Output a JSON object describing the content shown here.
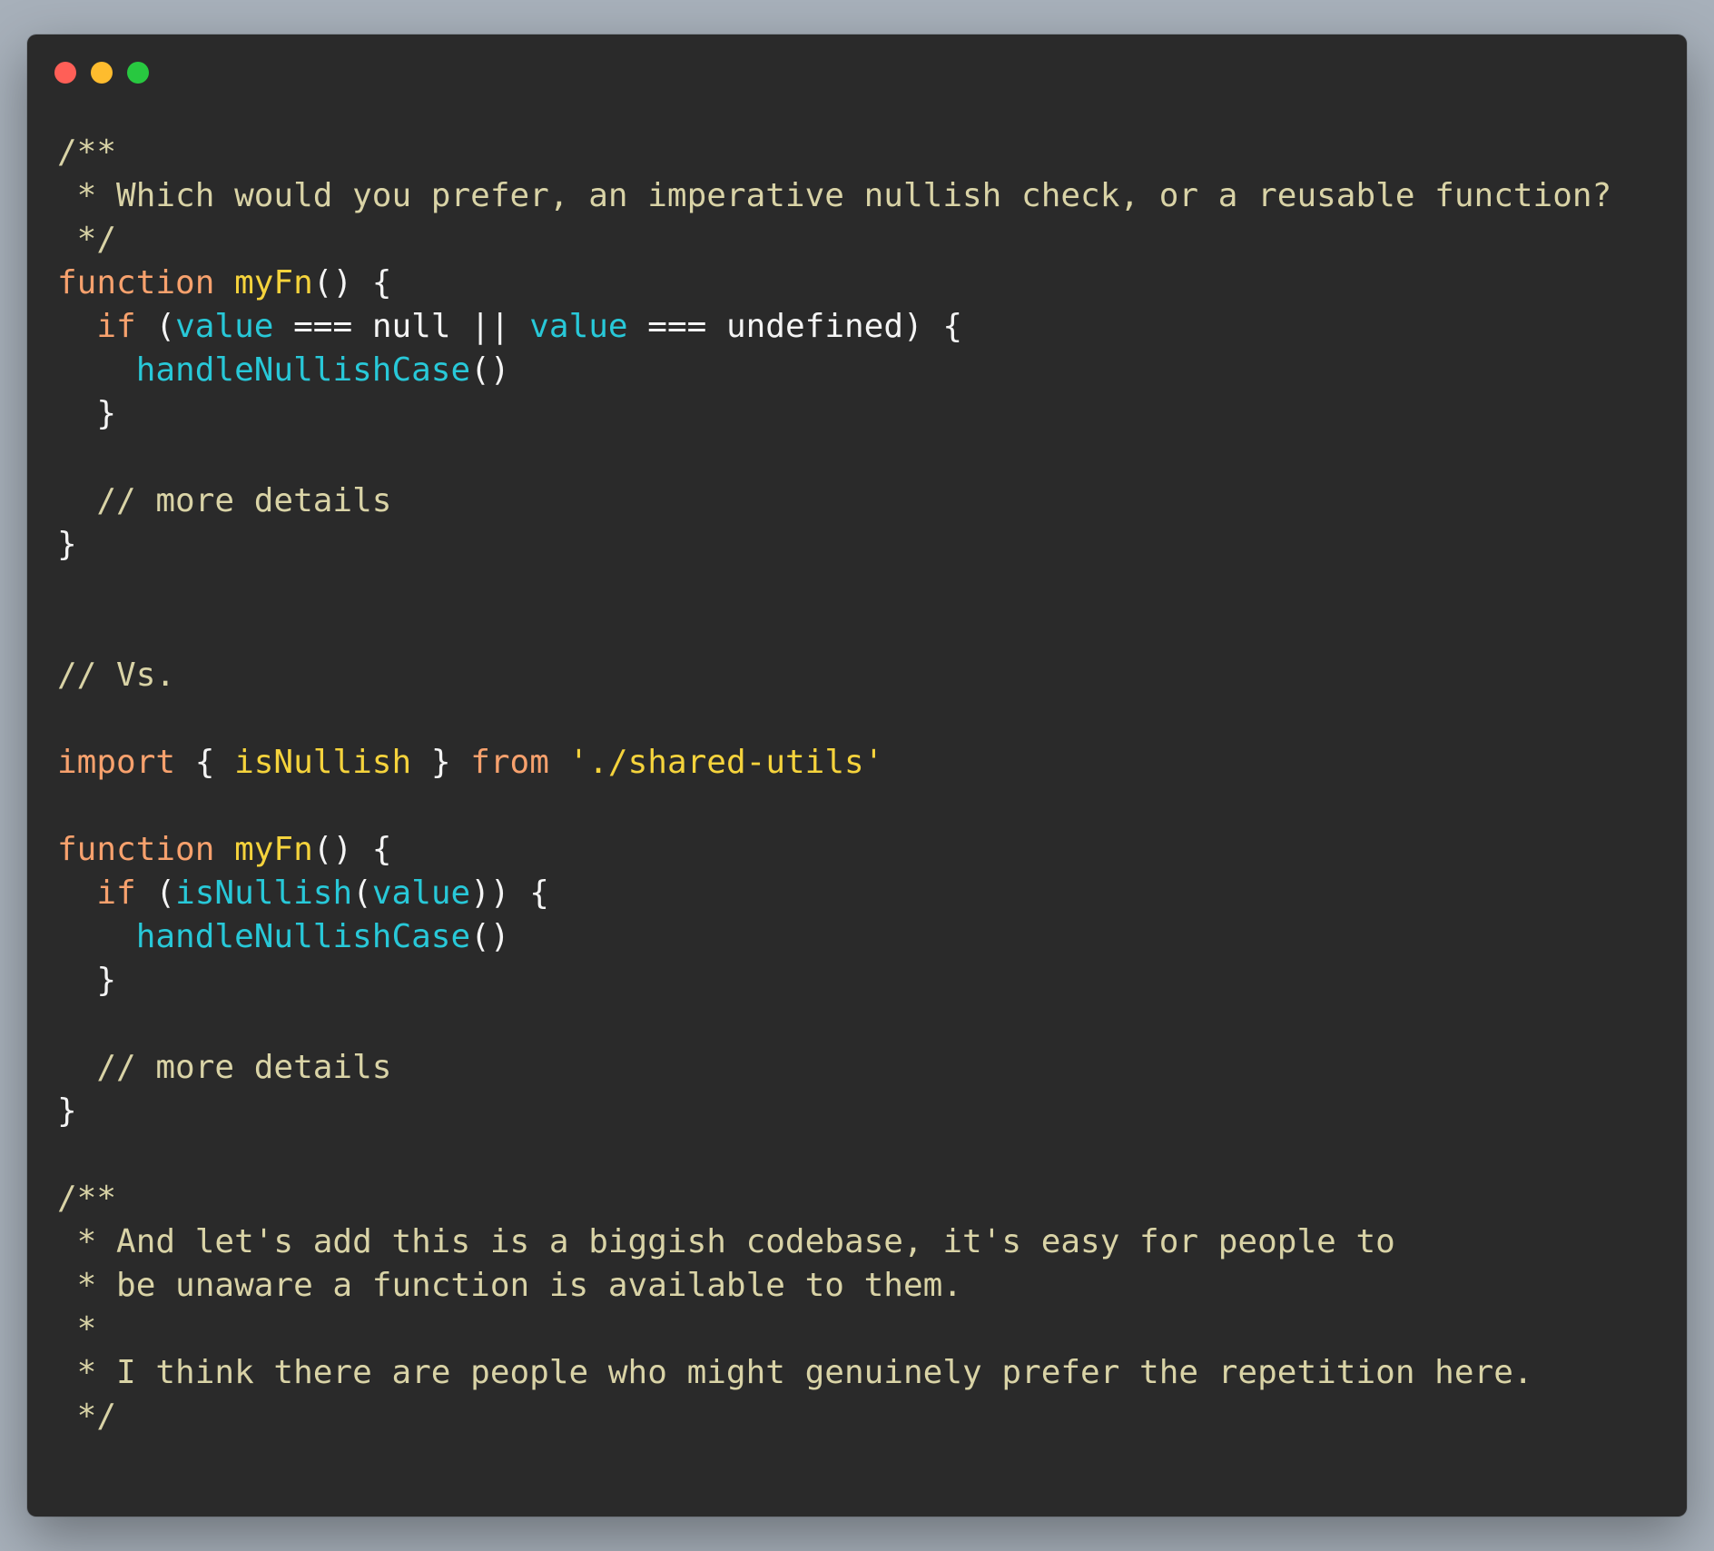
{
  "window": {
    "traffic_lights": [
      {
        "name": "close",
        "color": "#ff5f57"
      },
      {
        "name": "minimize",
        "color": "#febc2e"
      },
      {
        "name": "zoom",
        "color": "#28c840"
      }
    ]
  },
  "colors": {
    "background": "#a7b0ba",
    "window_bg": "#2a2a2a",
    "comment": "#d9d3a6",
    "keyword": "#f7a16d",
    "function_name": "#f5d33c",
    "identifier": "#28c8d8",
    "plain": "#f4f4f4",
    "string": "#f5d33c"
  },
  "code": {
    "lines": [
      [
        {
          "t": "comment",
          "v": "/**"
        }
      ],
      [
        {
          "t": "comment",
          "v": " * Which would you prefer, an imperative nullish check, or a reusable function?"
        }
      ],
      [
        {
          "t": "comment",
          "v": " */"
        }
      ],
      [
        {
          "t": "keyword",
          "v": "function"
        },
        {
          "t": "plain",
          "v": " "
        },
        {
          "t": "func",
          "v": "myFn"
        },
        {
          "t": "plain",
          "v": "() {"
        }
      ],
      [
        {
          "t": "plain",
          "v": "  "
        },
        {
          "t": "keyword",
          "v": "if"
        },
        {
          "t": "plain",
          "v": " ("
        },
        {
          "t": "ident",
          "v": "value"
        },
        {
          "t": "plain",
          "v": " === null || "
        },
        {
          "t": "ident",
          "v": "value"
        },
        {
          "t": "plain",
          "v": " === undefined) {"
        }
      ],
      [
        {
          "t": "plain",
          "v": "    "
        },
        {
          "t": "ident",
          "v": "handleNullishCase"
        },
        {
          "t": "plain",
          "v": "()"
        }
      ],
      [
        {
          "t": "plain",
          "v": "  }"
        }
      ],
      [],
      [
        {
          "t": "comment",
          "v": "  // more details"
        }
      ],
      [
        {
          "t": "plain",
          "v": "}"
        }
      ],
      [],
      [],
      [
        {
          "t": "comment",
          "v": "// Vs."
        }
      ],
      [],
      [
        {
          "t": "keyword",
          "v": "import"
        },
        {
          "t": "plain",
          "v": " { "
        },
        {
          "t": "func",
          "v": "isNullish"
        },
        {
          "t": "plain",
          "v": " } "
        },
        {
          "t": "keyword",
          "v": "from"
        },
        {
          "t": "plain",
          "v": " "
        },
        {
          "t": "string",
          "v": "'./shared-utils'"
        }
      ],
      [],
      [
        {
          "t": "keyword",
          "v": "function"
        },
        {
          "t": "plain",
          "v": " "
        },
        {
          "t": "func",
          "v": "myFn"
        },
        {
          "t": "plain",
          "v": "() {"
        }
      ],
      [
        {
          "t": "plain",
          "v": "  "
        },
        {
          "t": "keyword",
          "v": "if"
        },
        {
          "t": "plain",
          "v": " ("
        },
        {
          "t": "ident",
          "v": "isNullish"
        },
        {
          "t": "plain",
          "v": "("
        },
        {
          "t": "ident",
          "v": "value"
        },
        {
          "t": "plain",
          "v": ")) {"
        }
      ],
      [
        {
          "t": "plain",
          "v": "    "
        },
        {
          "t": "ident",
          "v": "handleNullishCase"
        },
        {
          "t": "plain",
          "v": "()"
        }
      ],
      [
        {
          "t": "plain",
          "v": "  }"
        }
      ],
      [],
      [
        {
          "t": "comment",
          "v": "  // more details"
        }
      ],
      [
        {
          "t": "plain",
          "v": "}"
        }
      ],
      [],
      [
        {
          "t": "comment",
          "v": "/**"
        }
      ],
      [
        {
          "t": "comment",
          "v": " * And let's add this is a biggish codebase, it's easy for people to"
        }
      ],
      [
        {
          "t": "comment",
          "v": " * be unaware a function is available to them."
        }
      ],
      [
        {
          "t": "comment",
          "v": " *"
        }
      ],
      [
        {
          "t": "comment",
          "v": " * I think there are people who might genuinely prefer the repetition here."
        }
      ],
      [
        {
          "t": "comment",
          "v": " */"
        }
      ]
    ]
  }
}
